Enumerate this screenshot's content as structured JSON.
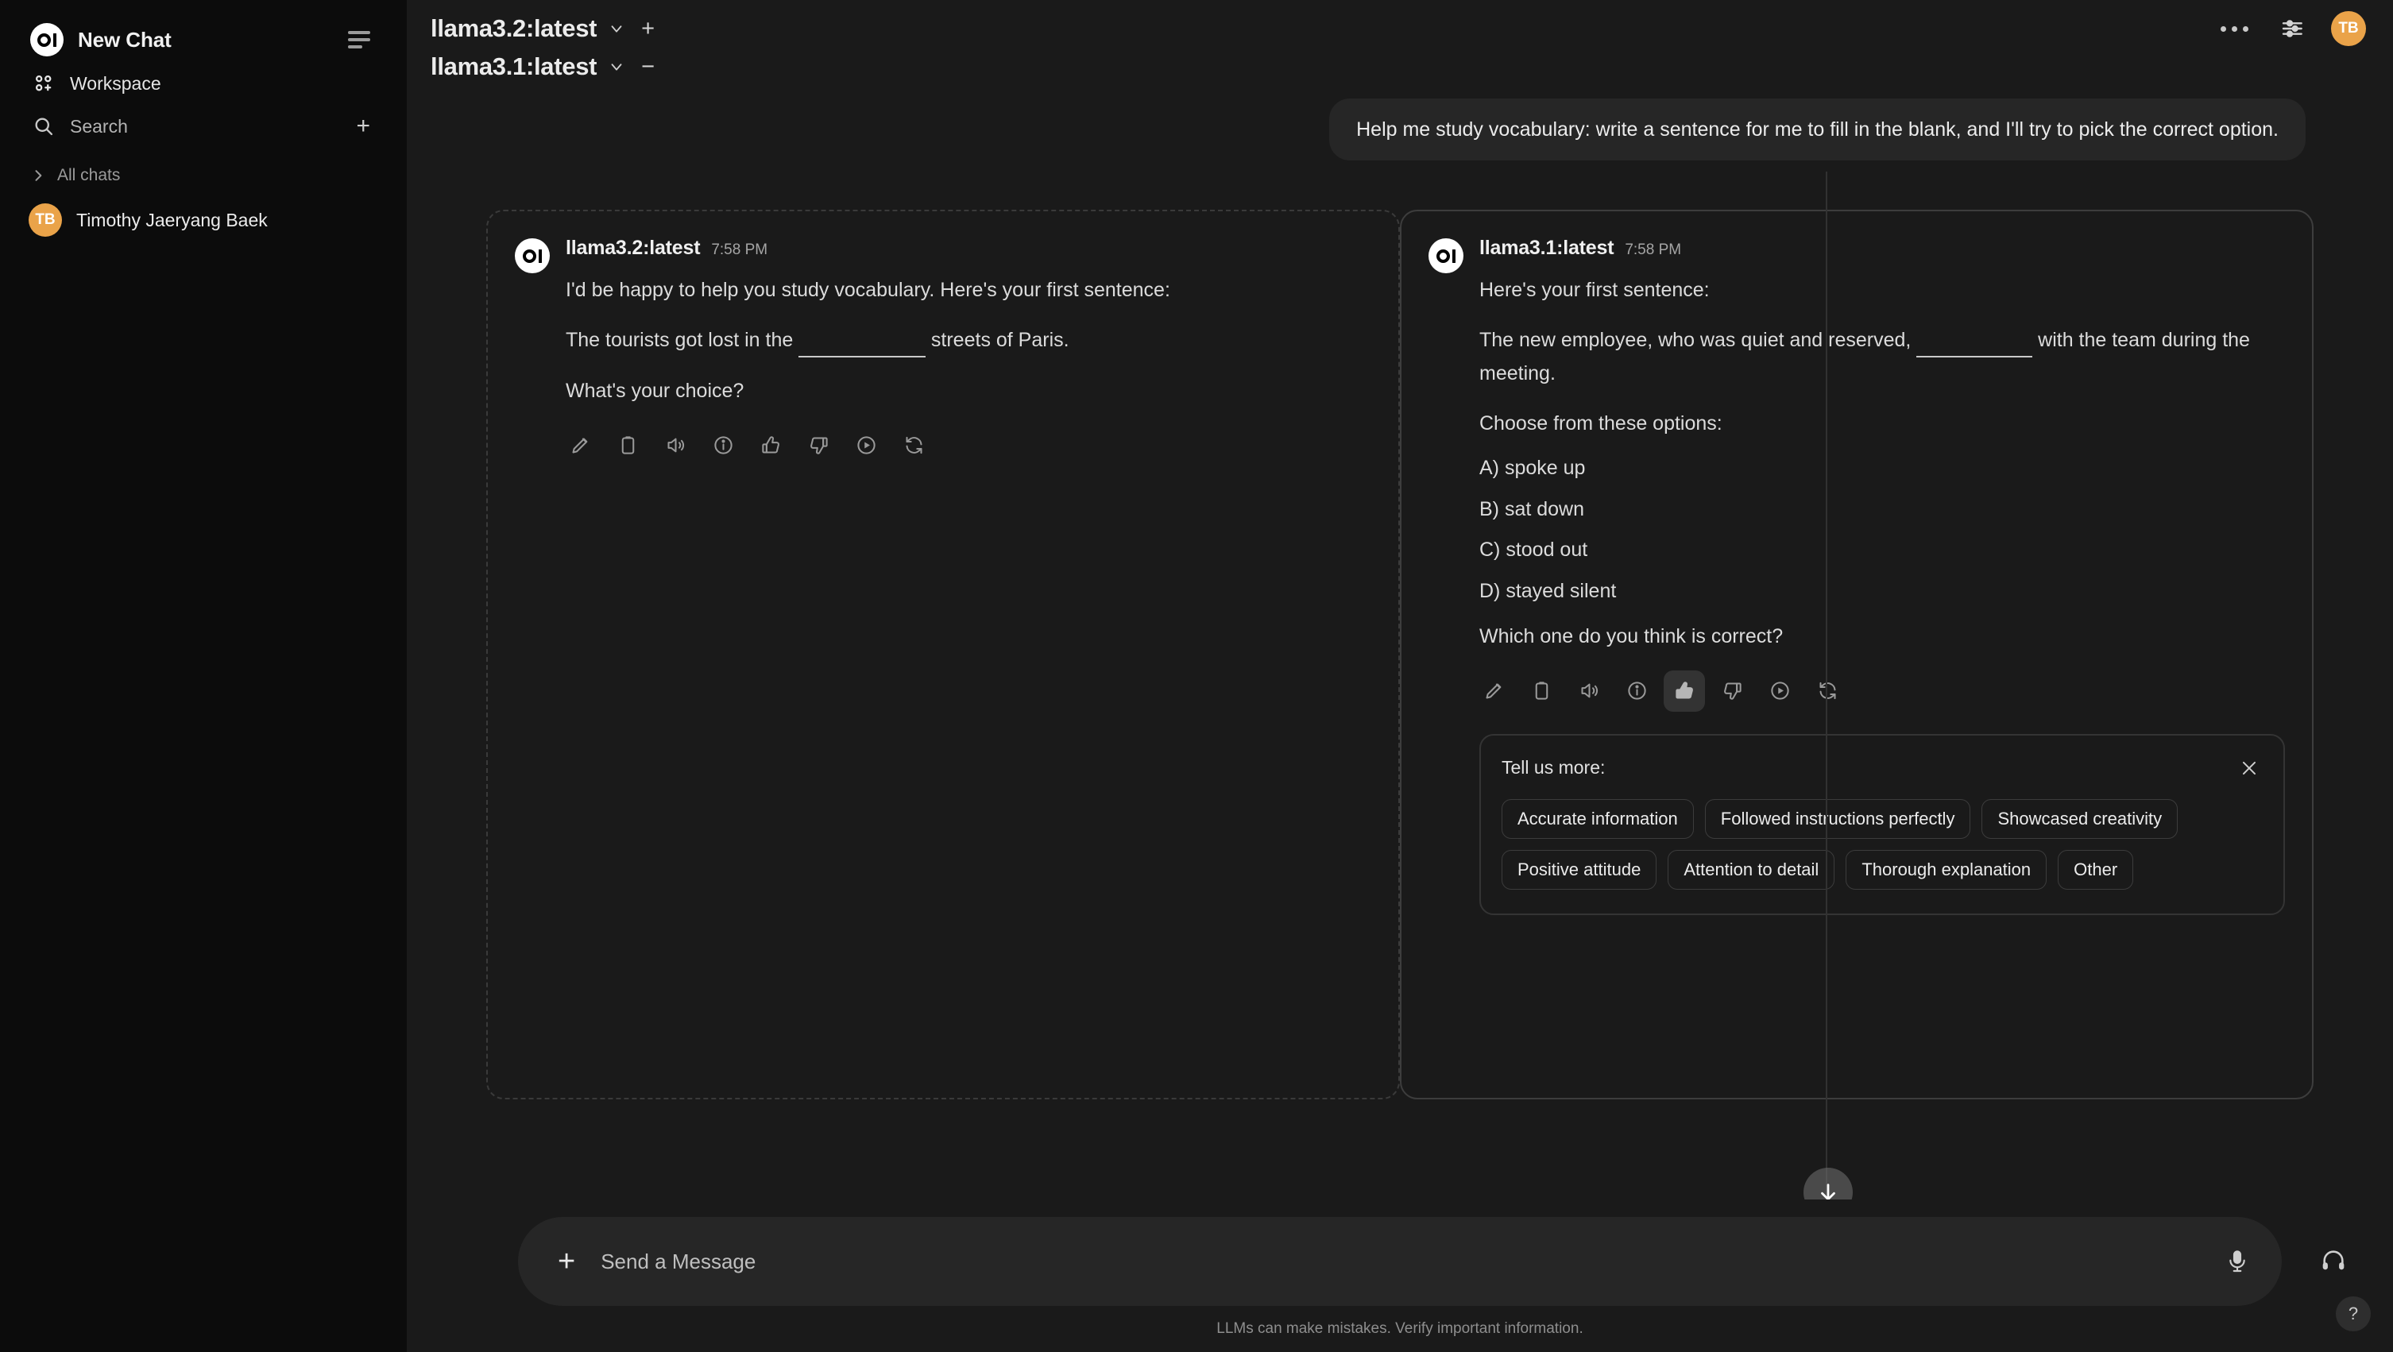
{
  "sidebar": {
    "brand_label": "New Chat",
    "menu_icon": "hamburger-icon",
    "workspace_label": "Workspace",
    "search_label": "Search",
    "new_chat_plus": "+",
    "all_chats_label": "All chats",
    "user": {
      "initials": "TB",
      "name": "Timothy Jaeryang Baek"
    }
  },
  "topbar": {
    "models": [
      {
        "name": "llama3.2:latest",
        "control": "+"
      },
      {
        "name": "llama3.1:latest",
        "control": "−"
      }
    ],
    "more_icon": "ellipsis-icon",
    "controls_icon": "sliders-icon",
    "avatar_initials": "TB",
    "accent_color": "#eaa349"
  },
  "conversation": {
    "user_message": "Help me study vocabulary: write a sentence for me to fill in the blank, and I'll try to pick the correct option.",
    "responses": [
      {
        "model": "llama3.2:latest",
        "timestamp": "7:58 PM",
        "line1": "I'd be happy to help you study vocabulary. Here's your first sentence:",
        "line2_before": "The tourists got lost in the ",
        "line2_after": " streets of Paris.",
        "line3": "What's your choice?",
        "selected": false
      },
      {
        "model": "llama3.1:latest",
        "timestamp": "7:58 PM",
        "line1": "Here's your first sentence:",
        "line2_before": "The new employee, who was quiet and reserved, ",
        "line2_after": " with the team during the meeting.",
        "line3": "Choose from these options:",
        "options": [
          "A) spoke up",
          "B) sat down",
          "C) stood out",
          "D) stayed silent"
        ],
        "line4": "Which one do you think is correct?",
        "selected": true
      }
    ],
    "action_icons": [
      "edit-icon",
      "copy-icon",
      "speaker-icon",
      "info-icon",
      "thumbs-up-icon",
      "thumbs-down-icon",
      "play-circle-icon",
      "regenerate-icon"
    ],
    "scroll_to_bottom_icon": "arrow-down-icon"
  },
  "feedback": {
    "title": "Tell us more:",
    "close_icon": "close-icon",
    "tags": [
      "Accurate information",
      "Followed instructions perfectly",
      "Showcased creativity",
      "Positive attitude",
      "Attention to detail",
      "Thorough explanation",
      "Other"
    ]
  },
  "composer": {
    "add_label": "+",
    "placeholder": "Send a Message",
    "mic_icon": "microphone-icon",
    "headphone_icon": "headphone-icon"
  },
  "footer": {
    "disclaimer": "LLMs can make mistakes. Verify important information.",
    "help_label": "?"
  }
}
